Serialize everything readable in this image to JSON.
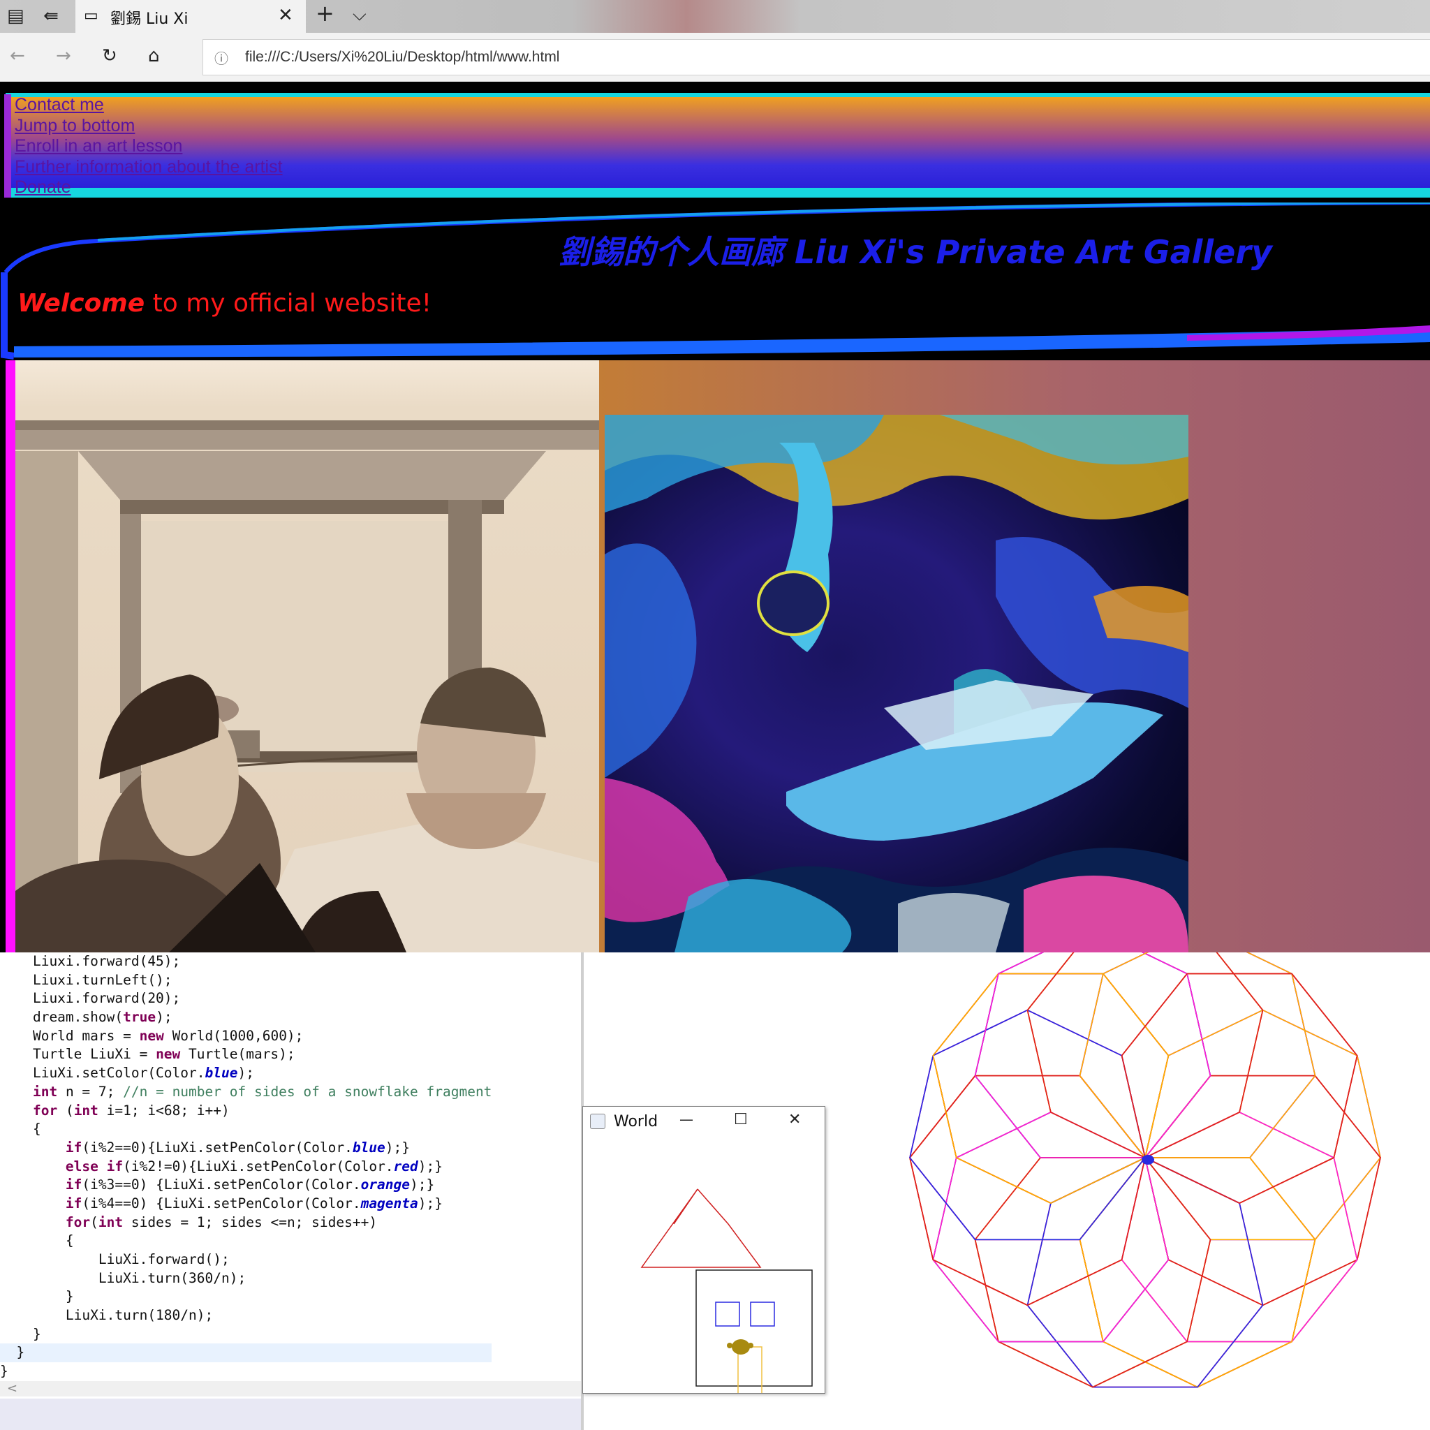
{
  "browser": {
    "tab_title": "劉錫 Liu Xi",
    "url": "file:///C:/Users/Xi%20Liu/Desktop/html/www.html",
    "new_tab_glyph": "+",
    "tab_menu_glyph": "⌵"
  },
  "nav": {
    "links": [
      "Contact me",
      "Jump to bottom",
      "Enroll in an art lesson",
      "Further information about the artist",
      "Donate"
    ]
  },
  "header": {
    "title": "劉錫的个人画廊 Liu Xi's Private Art Gallery",
    "welcome_emph": "Welcome",
    "welcome_rest": " to my official website!"
  },
  "code": {
    "lines": [
      "    Liuxi.forward(45);",
      "    Liuxi.turnLeft();",
      "    Liuxi.forward(20);",
      "    dream.show(true);",
      "    World mars = new World(1000,600);",
      "    Turtle LiuXi = new Turtle(mars);",
      "    LiuXi.setColor(Color.blue);",
      "    int n = 7; //n = number of sides of a snowflake fragment",
      "    for (int i=1; i<68; i++)",
      "    {",
      "        if(i%2==0){LiuXi.setPenColor(Color.blue);}",
      "        else if(i%2!=0){LiuXi.setPenColor(Color.red);}",
      "        if(i%3==0) {LiuXi.setPenColor(Color.orange);}",
      "        if(i%4==0) {LiuXi.setPenColor(Color.magenta);}",
      "        for(int sides = 1; sides <=n; sides++)",
      "        {",
      "            LiuXi.forward();",
      "            LiuXi.turn(360/n);",
      "        }",
      "        LiuXi.turn(180/n);",
      "    }",
      "  }",
      "}"
    ],
    "scroll_left_glyph": "<"
  },
  "world_window": {
    "title": "World",
    "minimize_glyph": "—",
    "maximize_glyph": "☐",
    "close_glyph": "✕"
  },
  "colors": {
    "nav_top": "#f0a020",
    "nav_bottom": "#2a20d8",
    "cyan_band": "#16d6e0",
    "title_blue": "#1b1fe8",
    "welcome_red": "#ff1a1a",
    "spiro": [
      "#2a2ae0",
      "#e02020",
      "#ffb000",
      "#ff20d0"
    ]
  }
}
